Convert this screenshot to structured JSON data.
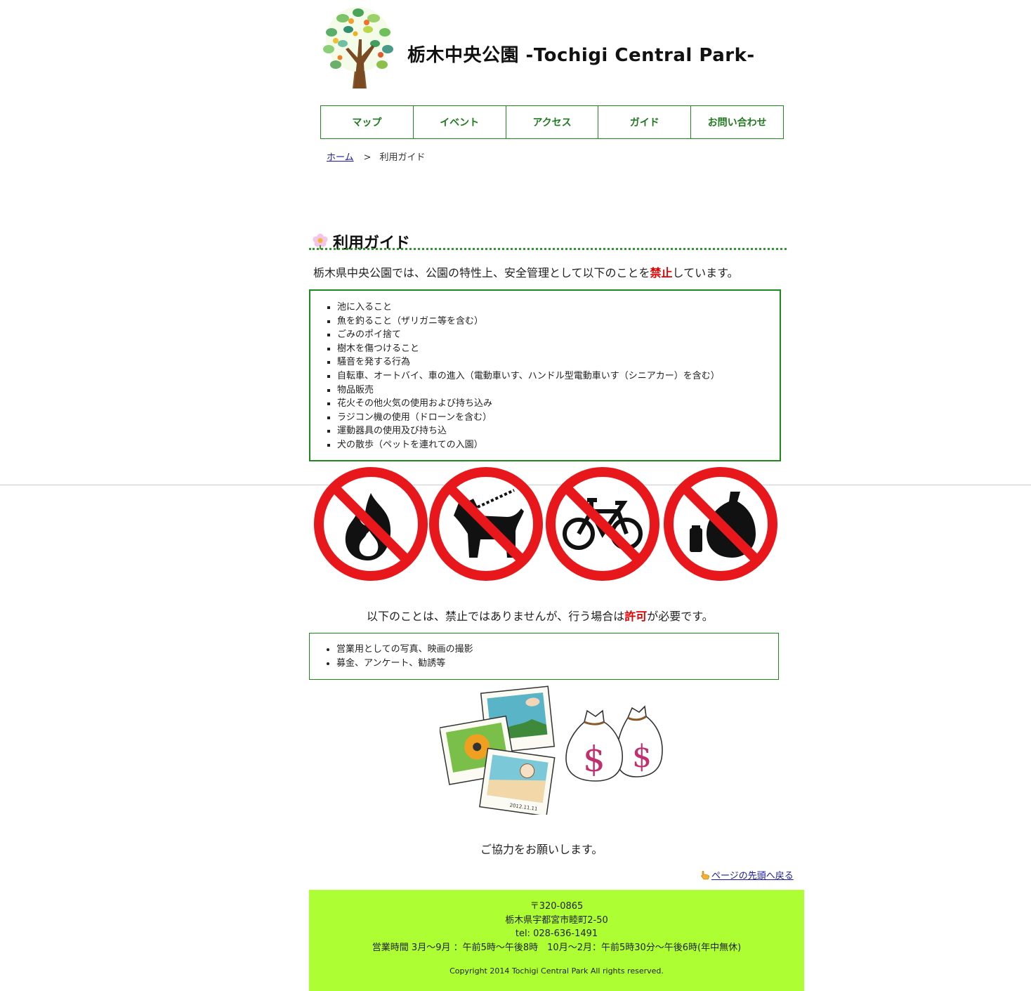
{
  "header": {
    "title": "栃木中央公園 -Tochigi Central Park-"
  },
  "nav": {
    "items": [
      {
        "label": "マップ"
      },
      {
        "label": "イベント"
      },
      {
        "label": "アクセス"
      },
      {
        "label": "ガイド"
      },
      {
        "label": "お問い合わせ"
      }
    ]
  },
  "breadcrumb": {
    "home": "ホーム",
    "separator": ">",
    "current": "利用ガイド"
  },
  "main": {
    "heading": "利用ガイド",
    "prohibited_intro_before": "栃木県中央公園では、公園の特性上、安全管理として以下のことを",
    "prohibited_intro_emph": "禁止",
    "prohibited_intro_after": "しています。",
    "prohibited_items": [
      "池に入ること",
      "魚を釣ること（ザリガニ等を含む）",
      "ごみのポイ捨て",
      "樹木を傷つけること",
      "騒音を発する行為",
      "自転車、オートバイ、車の進入（電動車いす、ハンドル型電動車いす（シニアカー）を含む）",
      "物品販売",
      "花火その他火気の使用および持ち込み",
      "ラジコン機の使用（ドローンを含む）",
      "運動器具の使用及び持ち込",
      "犬の散歩（ペットを連れての入園）"
    ],
    "signs": [
      {
        "icon": "no-fire-icon"
      },
      {
        "icon": "no-dogs-icon"
      },
      {
        "icon": "no-bicycles-icon"
      },
      {
        "icon": "no-litter-icon"
      }
    ],
    "permission_intro_before": "以下のことは、禁止ではありませんが、行う場合は",
    "permission_intro_emph": "許可",
    "permission_intro_after": "が必要です。",
    "permission_items": [
      "営業用としての写真、映画の撮影",
      "募金、アンケート、勧誘等"
    ],
    "photo_date": "2012.11.11",
    "money_symbol": "$",
    "thanks": "ご協力をお願いします。",
    "back_to_top": "ページの先頭へ戻る"
  },
  "footer": {
    "postal": "〒320-0865",
    "address": "栃木県宇都宮市睦町2-50",
    "tel": "tel: 028-636-1491",
    "hours": "営業時間 3月～9月 ：午前5時～午後8時　10月～2月：午前5時30分～午後6時(年中無休)",
    "copyright": "Copyright 2014 Tochigi Central Park All rights reserved."
  },
  "colors": {
    "accent_green": "#1e8a1e",
    "footer_bg": "#adff33",
    "prohibit_red": "#e00000",
    "sign_red": "#e8171b"
  }
}
